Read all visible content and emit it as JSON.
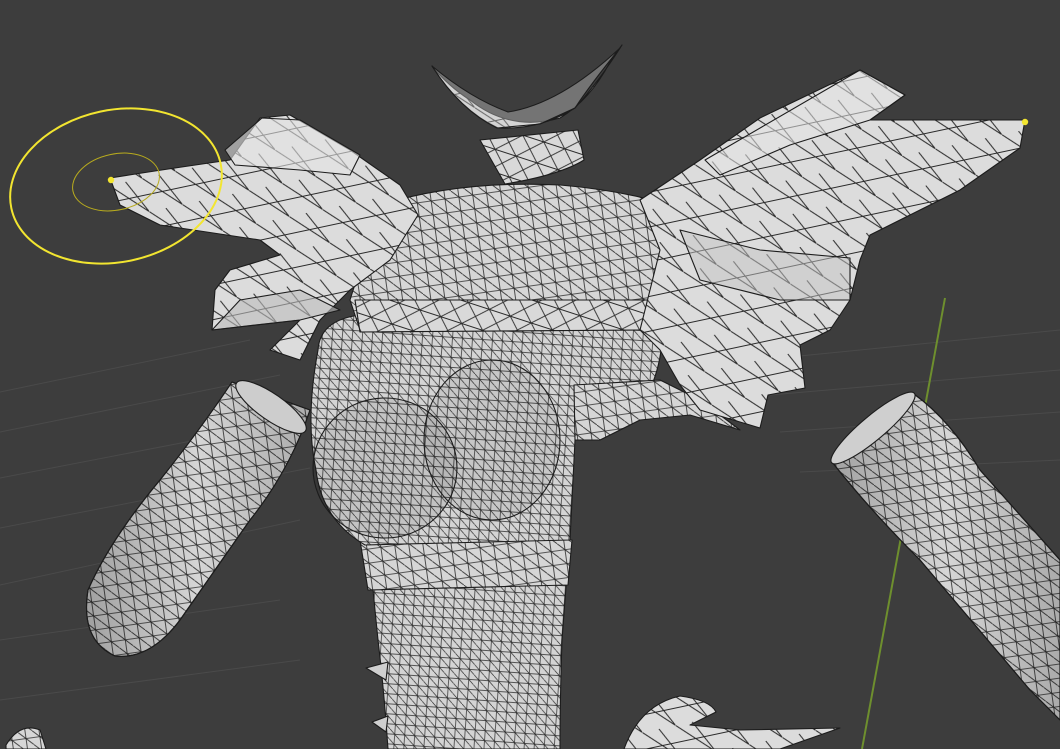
{
  "viewport": {
    "background_color": "#3d3d3d",
    "grid_line_color": "#4a4a4a",
    "y_axis_color": "#6e8f2e",
    "mesh_fill_color": "#d9d9d9",
    "mesh_shade_color": "#bdbdbd",
    "wire_color": "#1c1c1c",
    "selection_color": "#f2e530",
    "mode": "wireframe-overlay"
  },
  "objects": [
    {
      "name": "torso-mesh",
      "selected": false
    },
    {
      "name": "collar-mesh",
      "selected": false
    },
    {
      "name": "neck-mesh",
      "selected": false
    },
    {
      "name": "left-shoulder-pad-mesh",
      "selected": true
    },
    {
      "name": "right-shoulder-pad-mesh",
      "selected": false
    },
    {
      "name": "left-arm-mesh",
      "selected": false
    },
    {
      "name": "right-arm-mesh",
      "selected": false
    },
    {
      "name": "leg-fragment-mesh",
      "selected": false
    }
  ],
  "selection": {
    "active_vertex_count": 2,
    "proportional_editing_gizmo": true
  }
}
